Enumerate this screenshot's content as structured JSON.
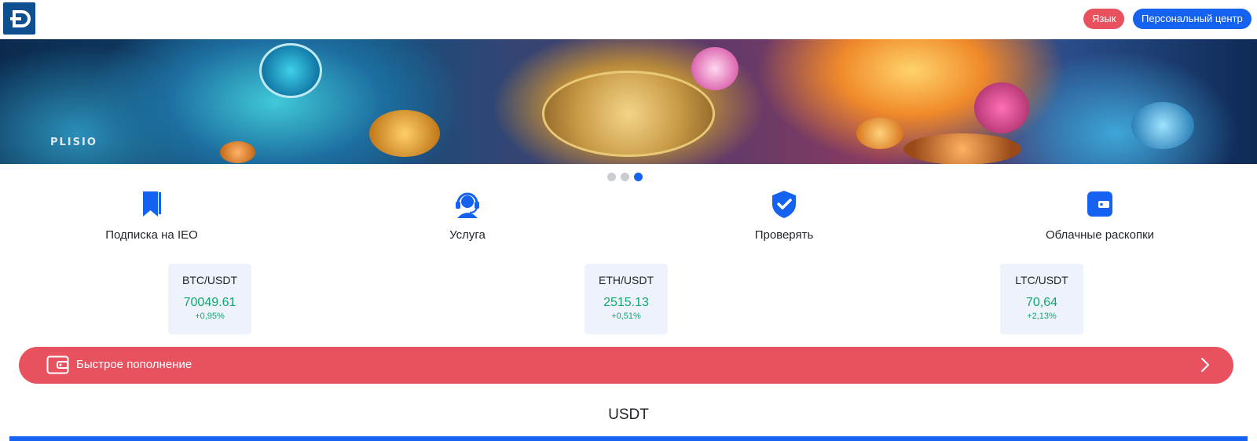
{
  "header": {
    "logo_icon": "exchange-logo-icon",
    "language_label": "Язык",
    "personal_center_label": "Персональный центр"
  },
  "banner": {
    "watermark_text": "PLISIO"
  },
  "carousel": {
    "slide_count": 3,
    "active_index": 2
  },
  "features": [
    {
      "icon": "bookmark-icon",
      "label": "Подписка на IEO"
    },
    {
      "icon": "headset-support-icon",
      "label": "Услуга"
    },
    {
      "icon": "shield-check-icon",
      "label": "Проверять"
    },
    {
      "icon": "wallet-icon",
      "label": "Облачные раскопки"
    }
  ],
  "tickers": [
    {
      "pair": "BTC/USDT",
      "price": "70049.61",
      "change": "+0,95%"
    },
    {
      "pair": "ETH/USDT",
      "price": "2515.13",
      "change": "+0,51%"
    },
    {
      "pair": "LTC/USDT",
      "price": "70,64",
      "change": "+2,13%"
    }
  ],
  "quick_deposit": {
    "icon": "wallet-icon",
    "label": "Быстрое пополнение",
    "arrow_icon": "chevron-right-icon"
  },
  "section": {
    "title": "USDT"
  },
  "colors": {
    "primary_blue": "#1662f0",
    "accent_red": "#e8525f",
    "up_green": "#12a56f",
    "ticker_bg": "#eef3fb"
  }
}
